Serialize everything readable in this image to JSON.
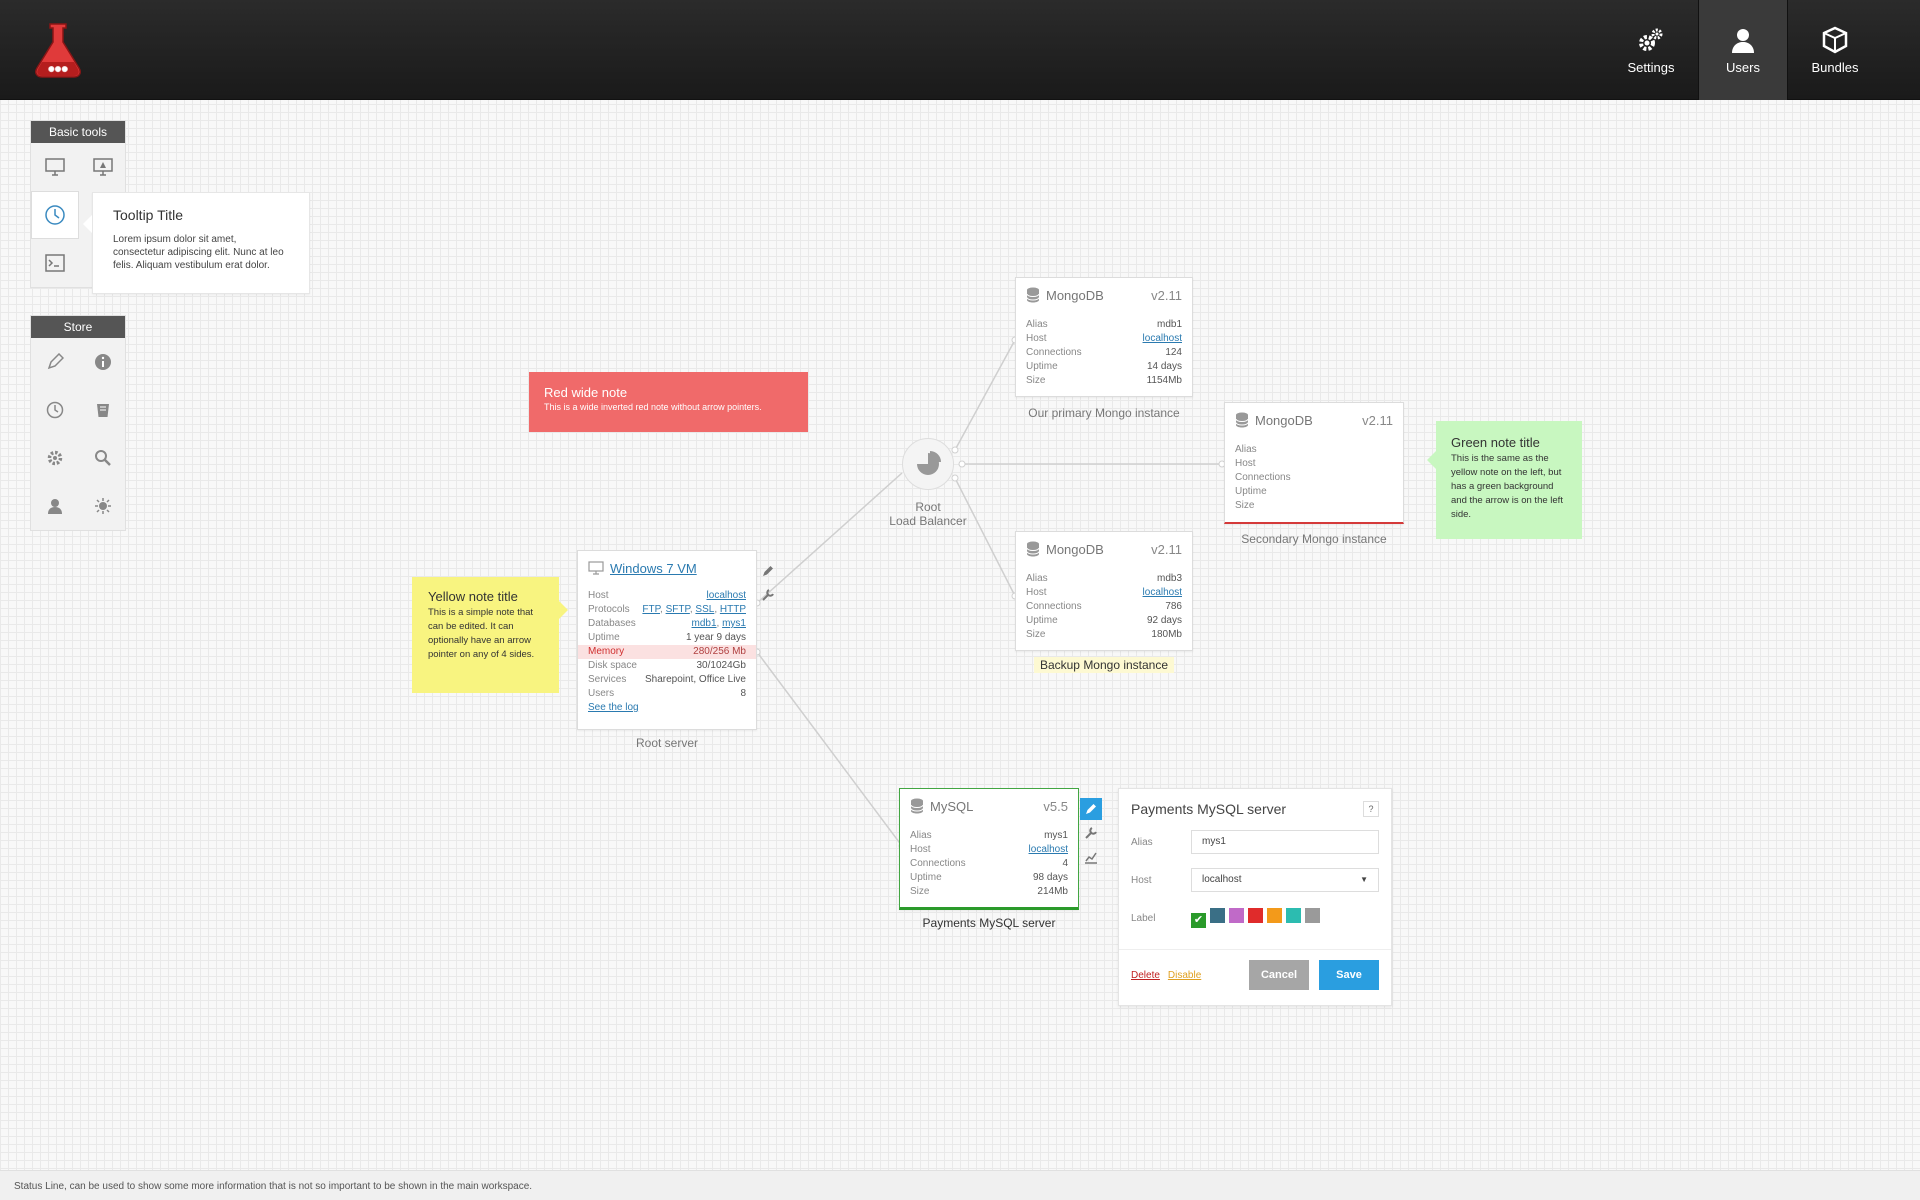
{
  "nav": {
    "settings": "Settings",
    "users": "Users",
    "bundles": "Bundles"
  },
  "basic_tools": {
    "title": "Basic tools",
    "tools": [
      "monitor-icon",
      "monitor-warning-icon",
      "clock-icon",
      "terminal-icon"
    ]
  },
  "tooltip": {
    "title": "Tooltip Title",
    "body": "Lorem ipsum dolor sit amet, consectetur adipiscing elit. Nunc at leo felis. Aliquam vestibulum erat dolor."
  },
  "store": {
    "title": "Store",
    "tools": [
      "pencil-icon",
      "info-icon",
      "clock-icon",
      "trash-icon",
      "gear-icon",
      "search-icon",
      "user-icon",
      "sun-icon"
    ]
  },
  "red_note": {
    "title": "Red wide note",
    "body": "This is a wide inverted red note without arrow pointers."
  },
  "yellow_note": {
    "title": "Yellow note title",
    "body": "This is a simple note that can be edited. It can optionally have an arrow pointer on any of 4 sides."
  },
  "green_note": {
    "title": "Green note title",
    "body": "This is the same as the yellow note on the left, but has a green background and the arrow is on the left side."
  },
  "load_balancer": {
    "line1": "Root",
    "line2": "Load Balancer"
  },
  "vm": {
    "title": "Windows 7 VM",
    "rows": [
      {
        "k": "Host",
        "v": "localhost"
      },
      {
        "k": "Protocols",
        "v": [
          "FTP",
          "SFTP",
          "SSL",
          "HTTP"
        ]
      },
      {
        "k": "Databases",
        "v": [
          "mdb1",
          "mys1"
        ]
      },
      {
        "k": "Uptime",
        "v": "1 year 9 days"
      },
      {
        "k": "Memory",
        "v": "280/256 Mb"
      },
      {
        "k": "Disk space",
        "v": "30/1024Gb"
      },
      {
        "k": "Services",
        "v": "Sharepoint, Office Live"
      },
      {
        "k": "Users",
        "v": "8"
      }
    ],
    "log_link": "See the log",
    "caption": "Root server"
  },
  "mongo1": {
    "title": "MongoDB",
    "version": "v2.11",
    "alias": "mdb1",
    "host": "localhost",
    "connections": "124",
    "uptime": "14 days",
    "size": "1154Mb",
    "caption": "Our primary Mongo instance",
    "labels": {
      "alias": "Alias",
      "host": "Host",
      "connections": "Connections",
      "uptime": "Uptime",
      "size": "Size"
    }
  },
  "mongo2": {
    "title": "MongoDB",
    "version": "v2.11",
    "caption": "Secondary Mongo instance",
    "labels": {
      "alias": "Alias",
      "host": "Host",
      "connections": "Connections",
      "uptime": "Uptime",
      "size": "Size"
    }
  },
  "mongo3": {
    "title": "MongoDB",
    "version": "v2.11",
    "alias": "mdb3",
    "host": "localhost",
    "connections": "786",
    "uptime": "92 days",
    "size": "180Mb",
    "caption": "Backup Mongo instance",
    "labels": {
      "alias": "Alias",
      "host": "Host",
      "connections": "Connections",
      "uptime": "Uptime",
      "size": "Size"
    }
  },
  "mysql": {
    "title": "MySQL",
    "version": "v5.5",
    "alias": "mys1",
    "host": "localhost",
    "connections": "4",
    "uptime": "98 days",
    "size": "214Mb",
    "caption": "Payments MySQL server",
    "labels": {
      "alias": "Alias",
      "host": "Host",
      "connections": "Connections",
      "uptime": "Uptime",
      "size": "Size"
    }
  },
  "form": {
    "title": "Payments MySQL server",
    "help": "?",
    "alias_label": "Alias",
    "alias_value": "mys1",
    "host_label": "Host",
    "host_value": "localhost",
    "label_label": "Label",
    "colors": [
      "#2a9a2a",
      "#3a6f86",
      "#c06ac8",
      "#e02b2b",
      "#f39a1a",
      "#2cbcb0",
      "#9a9a9a"
    ],
    "delete": "Delete",
    "disable": "Disable",
    "cancel": "Cancel",
    "save": "Save"
  },
  "status": "Status Line, can be used to show some more information that is not so important to be shown in the main workspace."
}
